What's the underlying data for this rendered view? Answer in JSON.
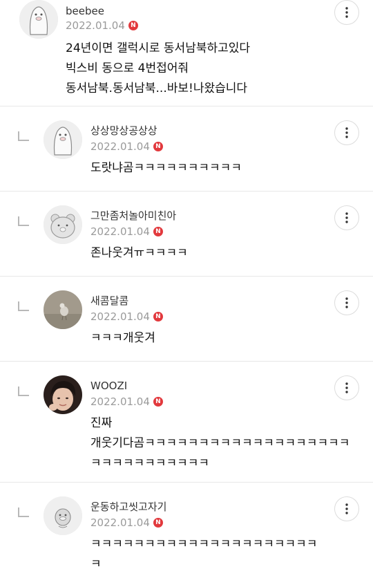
{
  "comments": [
    {
      "author": "beebee",
      "date": "2022.01.04",
      "badge": "N",
      "text": "24년이면 갤럭시로 동서남북하고있다\n빅스비 동으로 4번접어줘\n동서남북.동서남북...바보!나왔습니다",
      "avatar": "penguin-avatar"
    },
    {
      "author": "상상망상공상상",
      "date": "2022.01.04",
      "badge": "N",
      "text": "도랏냐곰ㅋㅋㅋㅋㅋㅋㅋㅋㅋㅋ",
      "avatar": "penguin-avatar"
    },
    {
      "author": "그만좀처놀아미친아",
      "date": "2022.01.04",
      "badge": "N",
      "text": "존나웃겨ㅠㅋㅋㅋㅋ",
      "avatar": "bear-avatar"
    },
    {
      "author": "새콤달콤",
      "date": "2022.01.04",
      "badge": "N",
      "text": "ㅋㅋㅋ개웃겨",
      "avatar": "bird-photo-avatar"
    },
    {
      "author": "WOOZI",
      "date": "2022.01.04",
      "badge": "N",
      "text": "진짜\n개웃기다곰ㅋㅋㅋㅋㅋㅋㅋㅋㅋㅋㅋㅋㅋㅋㅋㅋㅋㅋㅋ\nㅋㅋㅋㅋㅋㅋㅋㅋㅋㅋㅋ",
      "avatar": "person-photo-avatar"
    },
    {
      "author": "운동하고씻고자기",
      "date": "2022.01.04",
      "badge": "N",
      "text": "ㅋㅋㅋㅋㅋㅋㅋㅋㅋㅋㅋㅋㅋㅋㅋㅋㅋㅋㅋㅋㅋ\nㅋ",
      "avatar": "duck-avatar"
    }
  ],
  "icons": {
    "more": "more-vertical-icon",
    "reply": "reply-arrow-icon"
  },
  "colors": {
    "badge": "#e2393d",
    "date": "#9a9a9a",
    "divider": "#e7e7e7"
  }
}
